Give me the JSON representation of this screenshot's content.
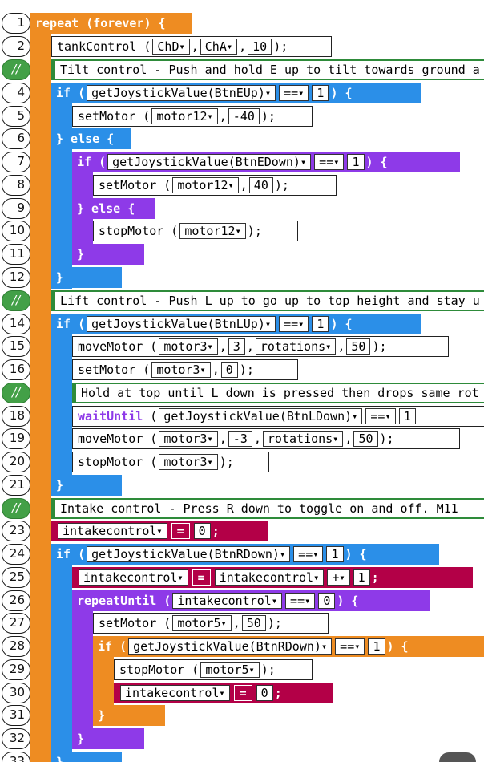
{
  "line_numbers": [
    "1",
    "2",
    "//",
    "4",
    "5",
    "6",
    "7",
    "8",
    "9",
    "10",
    "11",
    "12",
    "//",
    "14",
    "15",
    "16",
    "//",
    "18",
    "19",
    "20",
    "21",
    "//",
    "23",
    "24",
    "25",
    "26",
    "27",
    "28",
    "29",
    "30",
    "31",
    "32",
    "33"
  ],
  "code": {
    "l1": {
      "kw": "repeat",
      "arg": "(forever)",
      "brace": "{"
    },
    "l2": {
      "fn": "tankControl",
      "a1": "ChD",
      "a2": "ChA",
      "a3": "10",
      "end": ");"
    },
    "l3": {
      "comment": "Tilt control - Push and hold E up to tilt towards ground a"
    },
    "l4": {
      "kw": "if",
      "fn": "getJoystickValue(BtnEUp)",
      "op": "==",
      "val": "1",
      "brace": ") {"
    },
    "l5": {
      "fn": "setMotor",
      "a1": "motor12",
      "a2": "-40",
      "end": ");"
    },
    "l6": {
      "text": "} else {"
    },
    "l7": {
      "kw": "if",
      "fn": "getJoystickValue(BtnEDown)",
      "op": "==",
      "val": "1",
      "brace": ") {"
    },
    "l8": {
      "fn": "setMotor",
      "a1": "motor12",
      "a2": "40",
      "end": ");"
    },
    "l9": {
      "text": "} else {"
    },
    "l10": {
      "fn": "stopMotor",
      "a1": "motor12",
      "end": ");"
    },
    "l11": {
      "text": "}"
    },
    "l12": {
      "text": "}"
    },
    "l13": {
      "comment": "Lift control - Push L up to go up to top height and stay u"
    },
    "l14": {
      "kw": "if",
      "fn": "getJoystickValue(BtnLUp)",
      "op": "==",
      "val": "1",
      "brace": ") {"
    },
    "l15": {
      "fn": "moveMotor",
      "a1": "motor3",
      "a2": "3",
      "a3": "rotations",
      "a4": "50",
      "end": ");"
    },
    "l16": {
      "fn": "setMotor",
      "a1": "motor3",
      "a2": "0",
      "end": ");"
    },
    "l17": {
      "comment": "Hold at top until L down is pressed then drops same rot"
    },
    "l18": {
      "kw": "waitUntil",
      "fn": "getJoystickValue(BtnLDown)",
      "op": "==",
      "val": "1"
    },
    "l19": {
      "fn": "moveMotor",
      "a1": "motor3",
      "a2": "-3",
      "a3": "rotations",
      "a4": "50",
      "end": ");"
    },
    "l20": {
      "fn": "stopMotor",
      "a1": "motor3",
      "end": ");"
    },
    "l21": {
      "text": "}"
    },
    "l22": {
      "comment": "Intake control - Press R down to toggle on and off. M11"
    },
    "l23": {
      "var": "intakecontrol",
      "op": "=",
      "val": "0",
      "end": ";"
    },
    "l24": {
      "kw": "if",
      "fn": "getJoystickValue(BtnRDown)",
      "op": "==",
      "val": "1",
      "brace": ") {"
    },
    "l25": {
      "var": "intakecontrol",
      "op": "=",
      "var2": "intakecontrol",
      "op2": "+",
      "val": "1",
      "end": ";"
    },
    "l26": {
      "kw": "repeatUntil",
      "var": "intakecontrol",
      "op": "==",
      "val": "0",
      "brace": ") {"
    },
    "l27": {
      "fn": "setMotor",
      "a1": "motor5",
      "a2": "50",
      "end": ");"
    },
    "l28": {
      "kw": "if",
      "fn": "getJoystickValue(BtnRDown)",
      "op": "==",
      "val": "1",
      "brace": ") {"
    },
    "l29": {
      "fn": "stopMotor",
      "a1": "motor5",
      "end": ");"
    },
    "l30": {
      "var": "intakecontrol",
      "op": "=",
      "val": "0",
      "end": ";"
    },
    "l31": {
      "text": "}"
    },
    "l32": {
      "text": "}"
    },
    "l33": {
      "text": "}"
    }
  },
  "colors": {
    "orange": "#ee8c22",
    "blue": "#2b8fe8",
    "purple": "#8e3ae8",
    "green": "#43a047",
    "set": "#b30047"
  }
}
